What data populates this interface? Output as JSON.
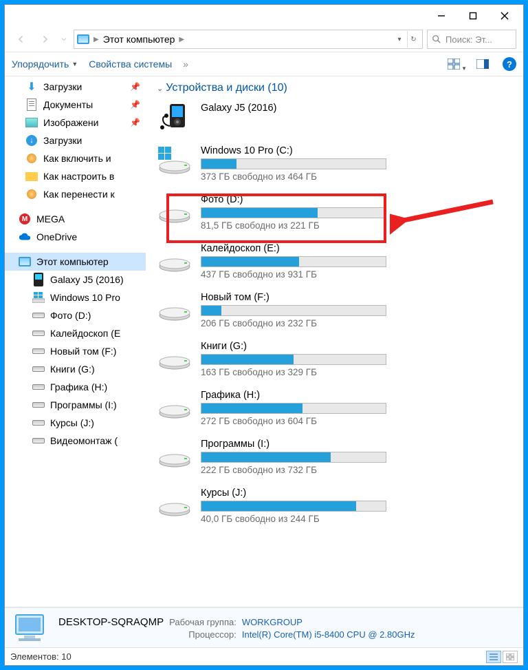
{
  "window": {
    "breadcrumb": "Этот компьютер",
    "search_placeholder": "Поиск: Эт..."
  },
  "toolbar": {
    "organize": "Упорядочить",
    "properties": "Свойства системы",
    "more": "»"
  },
  "sidebar": {
    "items": [
      {
        "label": "Загрузки",
        "icon": "download",
        "pinned": true
      },
      {
        "label": "Документы",
        "icon": "doc",
        "pinned": true
      },
      {
        "label": "Изображени",
        "icon": "img",
        "pinned": true
      },
      {
        "label": "Загрузки",
        "icon": "download2"
      },
      {
        "label": "Как включить и",
        "icon": "orange"
      },
      {
        "label": "Как настроить в",
        "icon": "folder"
      },
      {
        "label": "Как перенести к",
        "icon": "orange"
      }
    ],
    "cloud": [
      {
        "label": "MEGA",
        "icon": "mega"
      },
      {
        "label": "OneDrive",
        "icon": "onedrive"
      }
    ],
    "thispc": {
      "label": "Этот компьютер"
    },
    "drives": [
      {
        "label": "Galaxy J5 (2016)",
        "icon": "phone"
      },
      {
        "label": "Windows 10 Pro",
        "icon": "windrive"
      },
      {
        "label": "Фото  (D:)",
        "icon": "drive"
      },
      {
        "label": "Калейдоскоп (E",
        "icon": "drive"
      },
      {
        "label": "Новый том (F:)",
        "icon": "drive"
      },
      {
        "label": "Книги (G:)",
        "icon": "drive"
      },
      {
        "label": "Графика (H:)",
        "icon": "drive"
      },
      {
        "label": "Программы (I:)",
        "icon": "drive"
      },
      {
        "label": "Курсы (J:)",
        "icon": "drive"
      },
      {
        "label": "Видеомонтаж (",
        "icon": "drive"
      }
    ]
  },
  "group_header": "Устройства и диски (10)",
  "device": {
    "label": "Galaxy J5 (2016)"
  },
  "drives": [
    {
      "title": "Windows 10 Pro (C:)",
      "sub": "373 ГБ свободно из 464 ГБ",
      "pct": 19,
      "icon": "win"
    },
    {
      "title": "Фото  (D:)",
      "sub": "81,5 ГБ свободно из 221 ГБ",
      "pct": 63
    },
    {
      "title": "Калейдоскоп (E:)",
      "sub": "437 ГБ свободно из 931 ГБ",
      "pct": 53
    },
    {
      "title": "Новый том (F:)",
      "sub": "206 ГБ свободно из 232 ГБ",
      "pct": 11
    },
    {
      "title": "Книги (G:)",
      "sub": "163 ГБ свободно из 329 ГБ",
      "pct": 50
    },
    {
      "title": "Графика (H:)",
      "sub": "272 ГБ свободно из 604 ГБ",
      "pct": 55
    },
    {
      "title": "Программы (I:)",
      "sub": "222 ГБ свободно из 732 ГБ",
      "pct": 70
    },
    {
      "title": "Курсы (J:)",
      "sub": "40,0 ГБ свободно из 244 ГБ",
      "pct": 84
    }
  ],
  "info": {
    "name": "DESKTOP-SQRAQMP",
    "workgroup_k": "Рабочая группа:",
    "workgroup_v": "WORKGROUP",
    "cpu_k": "Процессор:",
    "cpu_v": "Intel(R) Core(TM) i5-8400 CPU @ 2.80GHz"
  },
  "status": {
    "count": "Элементов: 10"
  }
}
